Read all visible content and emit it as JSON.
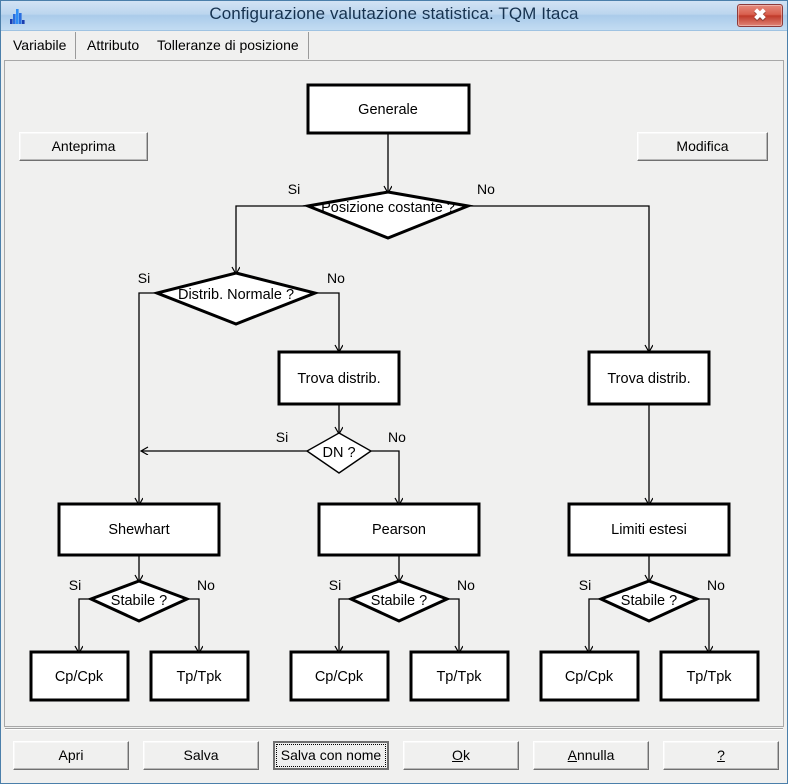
{
  "window": {
    "title": "Configurazione valutazione statistica: TQM Itaca",
    "app_icon": "histogram-icon",
    "close_label": "✖",
    "accent_title_bg": "#aacbea",
    "panel_bg": "#f0f0ef"
  },
  "tabs": [
    {
      "label": "Variabile",
      "selected": true
    },
    {
      "label": "Attributo",
      "selected": false
    },
    {
      "label": "Tolleranze di posizione",
      "selected": false
    }
  ],
  "toolbar": {
    "anteprima_label": "Anteprima",
    "modifica_label": "Modifica"
  },
  "flowchart": {
    "nodes": [
      {
        "id": "generale",
        "type": "process",
        "label": "Generale"
      },
      {
        "id": "posizione",
        "type": "decision",
        "label": "Posizione costante ?"
      },
      {
        "id": "distrib",
        "type": "decision",
        "label": "Distrib. Normale ?"
      },
      {
        "id": "trova1",
        "type": "process",
        "label": "Trova distrib."
      },
      {
        "id": "trova2",
        "type": "process",
        "label": "Trova distrib."
      },
      {
        "id": "dn",
        "type": "decision",
        "label": "DN ?"
      },
      {
        "id": "shewhart",
        "type": "process",
        "label": "Shewhart"
      },
      {
        "id": "pearson",
        "type": "process",
        "label": "Pearson"
      },
      {
        "id": "limiti",
        "type": "process",
        "label": "Limiti estesi"
      },
      {
        "id": "stabile1",
        "type": "decision",
        "label": "Stabile ?"
      },
      {
        "id": "stabile2",
        "type": "decision",
        "label": "Stabile ?"
      },
      {
        "id": "stabile3",
        "type": "decision",
        "label": "Stabile ?"
      },
      {
        "id": "cpcpk1",
        "type": "process",
        "label": "Cp/Cpk"
      },
      {
        "id": "tptpk1",
        "type": "process",
        "label": "Tp/Tpk"
      },
      {
        "id": "cpcpk2",
        "type": "process",
        "label": "Cp/Cpk"
      },
      {
        "id": "tptpk2",
        "type": "process",
        "label": "Tp/Tpk"
      },
      {
        "id": "cpcpk3",
        "type": "process",
        "label": "Cp/Cpk"
      },
      {
        "id": "tptpk3",
        "type": "process",
        "label": "Tp/Tpk"
      }
    ],
    "edge_labels": {
      "posizione_si": "Si",
      "posizione_no": "No",
      "distrib_si": "Si",
      "distrib_no": "No",
      "dn_si": "Si",
      "dn_no": "No",
      "stabile1_si": "Si",
      "stabile1_no": "No",
      "stabile2_si": "Si",
      "stabile2_no": "No",
      "stabile3_si": "Si",
      "stabile3_no": "No"
    }
  },
  "footer": {
    "apri": "Apri",
    "salva": "Salva",
    "salva_con_nome": "Salva con nome",
    "ok_pre": "O",
    "ok_post": "k",
    "annulla_pre": "A",
    "annulla_post": "nnulla",
    "help": "?"
  }
}
